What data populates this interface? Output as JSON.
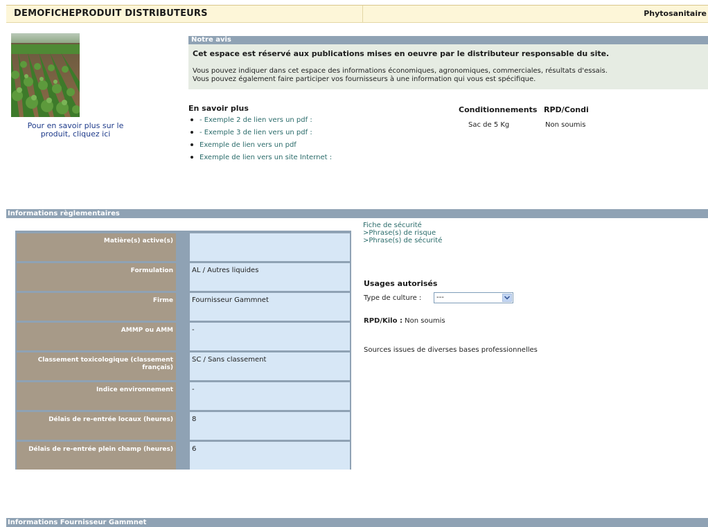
{
  "header": {
    "title": "DEMOFICHEPRODUIT DISTRIBUTEURS",
    "category": "Phytosanitaire"
  },
  "product": {
    "image_alt": "crop-field-photo",
    "link_text_1": "Pour en savoir plus sur le",
    "link_text_2": "produit, cliquez ici"
  },
  "avis": {
    "title": "Notre avis",
    "bold": "Cet espace est réservé aux publications mises en oeuvre par le distributeur responsable du site.",
    "line1": "Vous pouvez indiquer dans cet espace des informations économiques, agronomiques, commerciales, résultats d'essais.",
    "line2": "Vous pouvez également faire participer vos fournisseurs à une information qui vous est spécifique."
  },
  "en_savoir_plus": {
    "title": "En savoir plus",
    "links": [
      "- Exemple 2 de lien vers un pdf :",
      "- Exemple 3 de lien vers un pdf :",
      "Exemple de lien vers un pdf",
      "Exemple de lien vers un site Internet :"
    ]
  },
  "conditionnements": {
    "header_cond": "Conditionnements",
    "header_rpd": "RPD/Condi",
    "value_cond": "Sac de 5 Kg",
    "value_rpd": "Non soumis"
  },
  "reg_section": {
    "title": "Informations règlementaires",
    "rows": [
      {
        "label": "Matière(s) active(s)",
        "value": ""
      },
      {
        "label": "Formulation",
        "value": "AL / Autres liquides"
      },
      {
        "label": "Firme",
        "value": "Fournisseur Gammnet"
      },
      {
        "label": "AMMP ou AMM",
        "value": "-"
      },
      {
        "label": "Classement toxicologique (classement français)",
        "value": "SC / Sans classement"
      },
      {
        "label": "Indice environnement",
        "value": "-"
      },
      {
        "label": "Délais de re-entrée locaux (heures)",
        "value": "8"
      },
      {
        "label": "Délais de re-entrée plein champ (heures)",
        "value": "6"
      }
    ],
    "fiche_securite": "Fiche de sécurité",
    "phrases_risque": ">Phrase(s) de risque",
    "phrases_securite": ">Phrase(s) de sécurité",
    "usages_title": "Usages autorisés",
    "culture_label": "Type de culture :",
    "culture_selected": "---",
    "rpd_label": "RPD/Kilo :",
    "rpd_value": "Non soumis",
    "sources": "Sources issues de diverses bases professionnelles"
  },
  "fournisseur_section": {
    "title": "Informations Fournisseur Gammnet"
  },
  "colors": {
    "header_bg": "#fdf6d8",
    "bar_bg": "#8fa2b4",
    "label_bg": "#a79a88",
    "value_bg": "#d7e7f6",
    "avis_bg": "#e6ece3",
    "link": "#2a6b6a"
  }
}
